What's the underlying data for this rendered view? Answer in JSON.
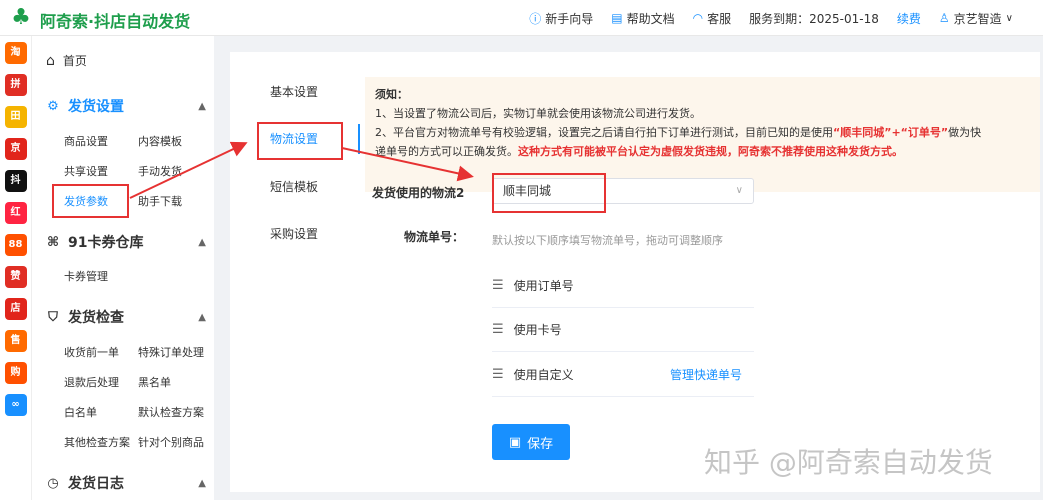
{
  "app": {
    "title": "阿奇索·抖店自动发货",
    "logo_icon": "logo-icon"
  },
  "topnav": {
    "guide": "新手向导",
    "docs": "帮助文档",
    "service": "客服",
    "expiry": "服务到期：2025-01-18",
    "renew": "续费",
    "user": "京艺智造"
  },
  "rail": {
    "apps": [
      {
        "label": "淘",
        "color": "#ff6a00"
      },
      {
        "label": "拼",
        "color": "#e02e24"
      },
      {
        "label": "田",
        "color": "#f5b400"
      },
      {
        "label": "京",
        "color": "#e1251b"
      },
      {
        "label": "抖",
        "color": "#111111"
      },
      {
        "label": "红",
        "color": "#ff2442"
      },
      {
        "label": "88",
        "color": "#ff5000"
      },
      {
        "label": "赞",
        "color": "#e02e24"
      },
      {
        "label": "店",
        "color": "#e1251b"
      },
      {
        "label": "售",
        "color": "#ff6a00"
      },
      {
        "label": "购",
        "color": "#ff5000"
      },
      {
        "label": "∞",
        "color": "#1890ff"
      }
    ]
  },
  "sidebar": {
    "home": "首页",
    "sec1": {
      "title": "发货设置",
      "items": [
        "商品设置",
        "内容模板",
        "共享设置",
        "手动发货",
        "发货参数",
        "助手下载"
      ]
    },
    "sec2": {
      "title": "91卡券仓库",
      "items": [
        "卡券管理"
      ]
    },
    "sec3": {
      "title": "发货检查",
      "items": [
        "收货前一单",
        "特殊订单处理",
        "退款后处理",
        "黑名单",
        "白名单",
        "默认检查方案",
        "其他检查方案",
        "针对个别商品"
      ]
    },
    "sec4": {
      "title": "发货日志"
    }
  },
  "tabs": [
    "基本设置",
    "物流设置",
    "短信模板",
    "采购设置"
  ],
  "notice": {
    "title": "须知：",
    "line1": "1、当设置了物流公司后，实物订单就会使用该物流公司进行发货。",
    "line2a": "2、平台官方对物流单号有校验逻辑，设置完之后请自行拍下订单进行测试，目前已知的是使用",
    "line2b": "“顺丰同城”+“订单号”",
    "line2c": "做为快",
    "line3a": "递单号的方式可以正确发货。",
    "line3b": "这种方式有可能被平台认定为虚假发货违规，阿奇索不推荐使用这种发货方式。"
  },
  "form": {
    "carrier_label": "发货使用的物流2",
    "carrier_value": "顺丰同城",
    "tracking_label": "物流单号：",
    "tracking_hint": "默认按以下顺序填写物流单号，拖动可调整顺序",
    "options": [
      {
        "label": "使用订单号",
        "link": ""
      },
      {
        "label": "使用卡号",
        "link": ""
      },
      {
        "label": "使用自定义",
        "link": "管理快递单号"
      }
    ],
    "save": "保存"
  },
  "watermark": "知乎 @阿奇索自动发货"
}
